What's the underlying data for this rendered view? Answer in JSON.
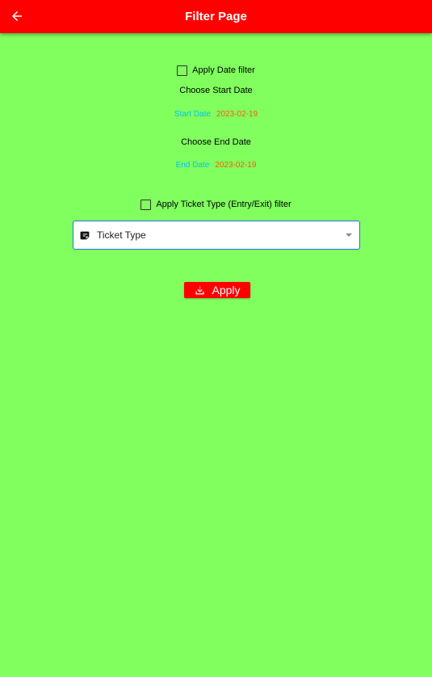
{
  "appbar": {
    "title": "Filter Page",
    "back_icon": "arrow-left-icon",
    "color": "#ff0000"
  },
  "date_filter": {
    "checkbox_label": "Apply Date filter",
    "checked": false,
    "start_heading": "Choose Start Date",
    "start_label": "Start Date",
    "start_value": "2023-02-19",
    "end_heading": "Choose End Date",
    "end_label": "End Date",
    "end_value": "2023-02-19"
  },
  "ticket_filter": {
    "checkbox_label": "Apply Ticket Type (Entry/Exit) filter",
    "checked": false,
    "dropdown_value": "Ticket Type",
    "dropdown_icon": "note-icon"
  },
  "apply_button": {
    "label": "Apply",
    "icon": "download-icon"
  },
  "colors": {
    "background": "#80ff5f",
    "date_label": "#00c2e6",
    "date_value": "#ff5a00",
    "accent": "#ff0000",
    "focus_border": "#1e73e8"
  }
}
